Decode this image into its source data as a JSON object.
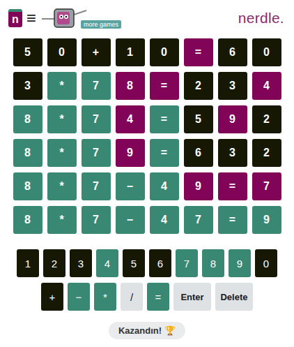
{
  "header": {
    "logo": "n",
    "menu": "≡",
    "more_games": "more games",
    "brand": "nerdle."
  },
  "board": {
    "rows": [
      [
        {
          "char": "5",
          "state": "absent"
        },
        {
          "char": "0",
          "state": "absent"
        },
        {
          "char": "+",
          "state": "absent"
        },
        {
          "char": "1",
          "state": "absent"
        },
        {
          "char": "0",
          "state": "absent"
        },
        {
          "char": "=",
          "state": "present"
        },
        {
          "char": "6",
          "state": "absent"
        },
        {
          "char": "0",
          "state": "absent"
        }
      ],
      [
        {
          "char": "3",
          "state": "absent"
        },
        {
          "char": "*",
          "state": "correct"
        },
        {
          "char": "7",
          "state": "correct"
        },
        {
          "char": "8",
          "state": "present"
        },
        {
          "char": "=",
          "state": "present"
        },
        {
          "char": "2",
          "state": "absent"
        },
        {
          "char": "3",
          "state": "absent"
        },
        {
          "char": "4",
          "state": "present"
        }
      ],
      [
        {
          "char": "8",
          "state": "correct"
        },
        {
          "char": "*",
          "state": "correct"
        },
        {
          "char": "7",
          "state": "correct"
        },
        {
          "char": "4",
          "state": "present"
        },
        {
          "char": "=",
          "state": "correct"
        },
        {
          "char": "5",
          "state": "absent"
        },
        {
          "char": "9",
          "state": "present"
        },
        {
          "char": "2",
          "state": "absent"
        }
      ],
      [
        {
          "char": "8",
          "state": "correct"
        },
        {
          "char": "*",
          "state": "correct"
        },
        {
          "char": "7",
          "state": "correct"
        },
        {
          "char": "9",
          "state": "present"
        },
        {
          "char": "=",
          "state": "correct"
        },
        {
          "char": "6",
          "state": "absent"
        },
        {
          "char": "3",
          "state": "absent"
        },
        {
          "char": "2",
          "state": "absent"
        }
      ],
      [
        {
          "char": "8",
          "state": "correct"
        },
        {
          "char": "*",
          "state": "correct"
        },
        {
          "char": "7",
          "state": "correct"
        },
        {
          "char": "−",
          "state": "correct"
        },
        {
          "char": "4",
          "state": "correct"
        },
        {
          "char": "9",
          "state": "present"
        },
        {
          "char": "=",
          "state": "present"
        },
        {
          "char": "7",
          "state": "present"
        }
      ],
      [
        {
          "char": "8",
          "state": "correct"
        },
        {
          "char": "*",
          "state": "correct"
        },
        {
          "char": "7",
          "state": "correct"
        },
        {
          "char": "−",
          "state": "correct"
        },
        {
          "char": "4",
          "state": "correct"
        },
        {
          "char": "7",
          "state": "correct"
        },
        {
          "char": "=",
          "state": "correct"
        },
        {
          "char": "9",
          "state": "correct"
        }
      ]
    ]
  },
  "keyboard": {
    "rows": [
      [
        {
          "label": "1",
          "state": "absent"
        },
        {
          "label": "2",
          "state": "absent"
        },
        {
          "label": "3",
          "state": "absent"
        },
        {
          "label": "4",
          "state": "correct"
        },
        {
          "label": "5",
          "state": "absent"
        },
        {
          "label": "6",
          "state": "absent"
        },
        {
          "label": "7",
          "state": "correct"
        },
        {
          "label": "8",
          "state": "correct"
        },
        {
          "label": "9",
          "state": "correct"
        },
        {
          "label": "0",
          "state": "absent"
        }
      ],
      [
        {
          "label": "+",
          "state": "absent"
        },
        {
          "label": "−",
          "state": "correct"
        },
        {
          "label": "*",
          "state": "correct"
        },
        {
          "label": "/",
          "state": "unused"
        },
        {
          "label": "=",
          "state": "correct"
        },
        {
          "label": "Enter",
          "state": "unused"
        },
        {
          "label": "Delete",
          "state": "unused"
        }
      ]
    ]
  },
  "status": {
    "text": "Kazandın!",
    "icon": "🏆"
  }
}
